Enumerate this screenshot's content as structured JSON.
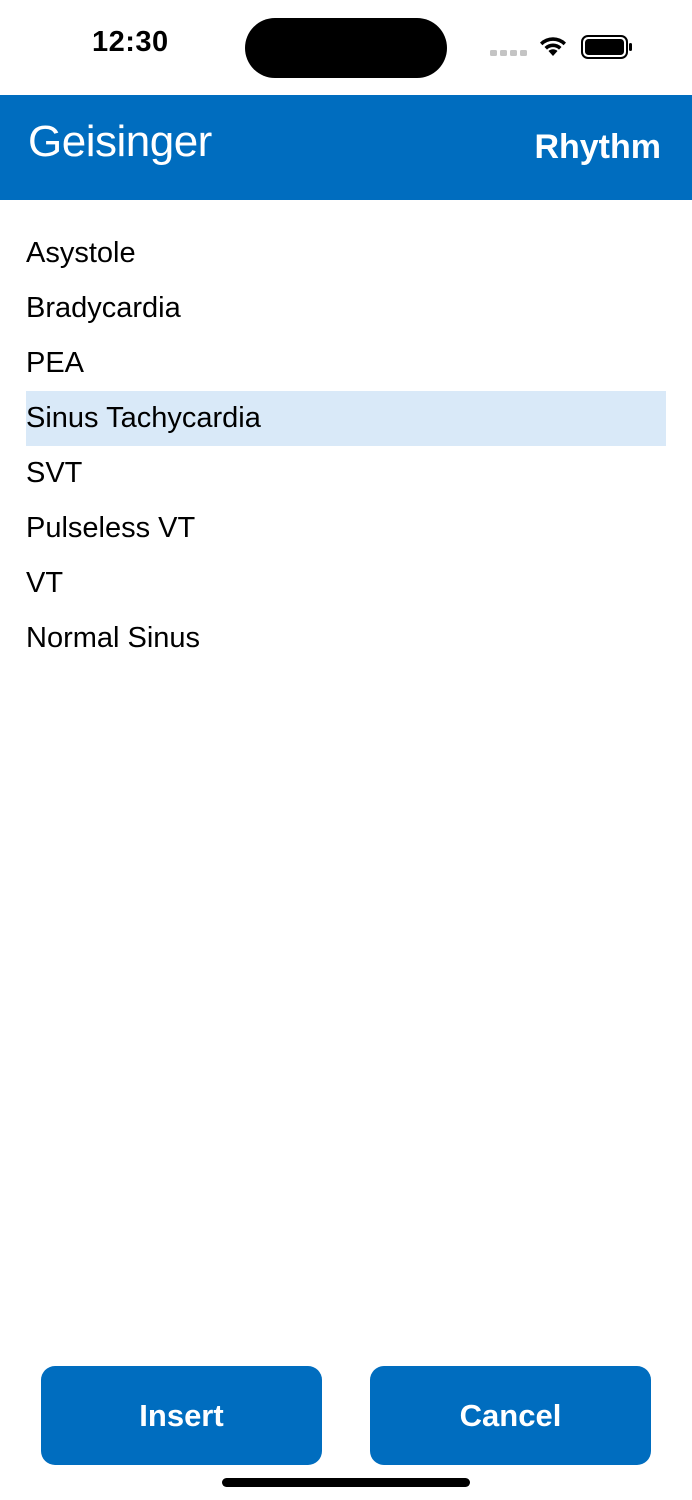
{
  "status_bar": {
    "time": "12:30",
    "icons": [
      "cellular-signal-icon",
      "wifi-icon",
      "battery-icon"
    ]
  },
  "header": {
    "brand": "Geisinger",
    "title": "Rhythm",
    "background_color": "#006dbf"
  },
  "rhythm_list": {
    "items": [
      {
        "label": "Asystole",
        "selected": false
      },
      {
        "label": "Bradycardia",
        "selected": false
      },
      {
        "label": "PEA",
        "selected": false
      },
      {
        "label": "Sinus Tachycardia",
        "selected": true
      },
      {
        "label": "SVT",
        "selected": false
      },
      {
        "label": "Pulseless VT",
        "selected": false
      },
      {
        "label": "VT",
        "selected": false
      },
      {
        "label": "Normal Sinus",
        "selected": false
      }
    ],
    "selected_highlight_color": "#d9e9f8"
  },
  "actions": {
    "insert_label": "Insert",
    "cancel_label": "Cancel",
    "button_color": "#006dbf"
  }
}
